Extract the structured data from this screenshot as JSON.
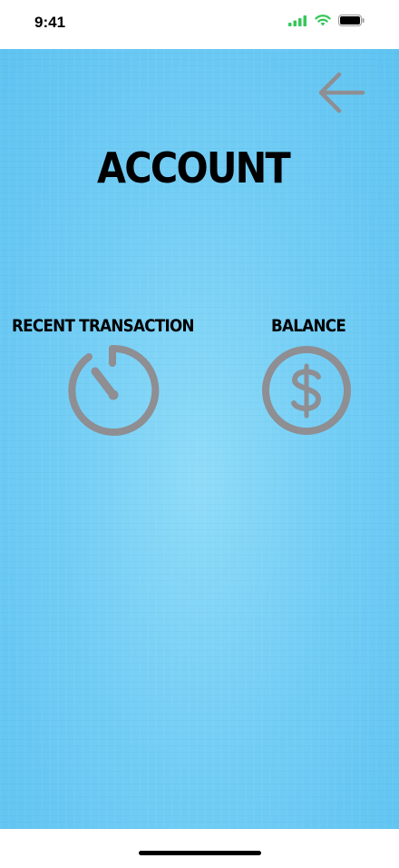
{
  "status_bar": {
    "time": "9:41",
    "icons": [
      "cellular-signal-icon",
      "wifi-icon",
      "battery-icon"
    ],
    "signal_color": "#34c759"
  },
  "header": {
    "back_icon": "arrow-left-icon",
    "title": "ACCOUNT"
  },
  "options": [
    {
      "label": "RECENT TRANSACTION",
      "icon": "stopwatch-icon"
    },
    {
      "label": "BALANCE",
      "icon": "dollar-circle-icon"
    }
  ],
  "colors": {
    "background": "#74cef5",
    "icon": "#8e8e93",
    "text": "#000000"
  }
}
